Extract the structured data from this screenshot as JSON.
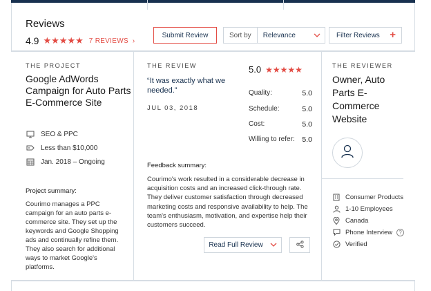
{
  "header": {
    "title": "Reviews",
    "rating": "4.9",
    "stars": "★★★★★",
    "review_count": "7 REVIEWS",
    "submit_label": "Submit Review",
    "sort_label": "Sort by",
    "sort_value": "Relevance",
    "filter_label": "Filter Reviews"
  },
  "project": {
    "section_label": "THE PROJECT",
    "title": "Google AdWords Campaign for Auto Parts E-Commerce Site",
    "service": "SEO & PPC",
    "budget": "Less than $10,000",
    "timeline": "Jan. 2018 – Ongoing",
    "summary_heading": "Project summary:",
    "summary": "Courimo manages a PPC campaign for an auto parts e-commerce site. They set up the keywords and Google Shopping ads and continually refine them. They also search for additional ways to market Google's platforms."
  },
  "review": {
    "section_label": "THE REVIEW",
    "quote": "“It was exactly what we needed.”",
    "date": "JUL 03, 2018",
    "score": "5.0",
    "stars": "★★★★★",
    "ratings": [
      {
        "label": "Quality:",
        "value": "5.0"
      },
      {
        "label": "Schedule:",
        "value": "5.0"
      },
      {
        "label": "Cost:",
        "value": "5.0"
      },
      {
        "label": "Willing to refer:",
        "value": "5.0"
      }
    ],
    "feedback_heading": "Feedback summary:",
    "feedback": "Courimo's work resulted in a considerable decrease in acquisition costs and an increased click-through rate. They deliver customer satisfaction through decreased marketing costs and responsive availability to help. The team's enthusiasm, motivation, and expertise help their customers succeed.",
    "read_full_label": "Read Full Review"
  },
  "reviewer": {
    "section_label": "THE REVIEWER",
    "title": "Owner, Auto Parts E-Commerce Website",
    "industry": "Consumer Products",
    "size": "1-10 Employees",
    "location": "Canada",
    "method": "Phone Interview",
    "status": "Verified",
    "help_glyph": "?"
  },
  "colors": {
    "accent": "#e34c44",
    "navy": "#18314f",
    "border": "#d6dde4"
  }
}
